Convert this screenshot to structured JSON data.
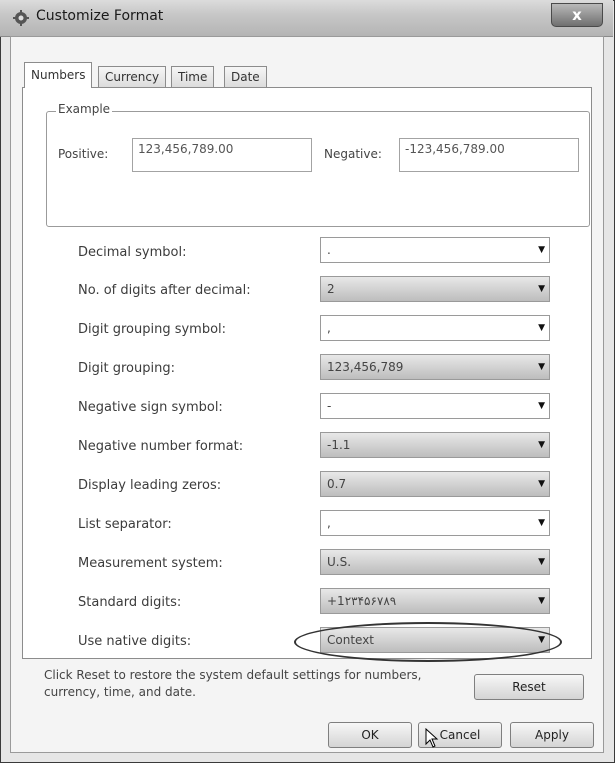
{
  "window": {
    "title": "Customize Format",
    "close_label": "x"
  },
  "tabs": [
    {
      "label": "Numbers",
      "active": true
    },
    {
      "label": "Currency",
      "active": false
    },
    {
      "label": "Time",
      "active": false
    },
    {
      "label": "Date",
      "active": false
    }
  ],
  "example": {
    "group_label": "Example",
    "positive_label": "Positive:",
    "positive_value": "123,456,789.00",
    "negative_label": "Negative:",
    "negative_value": "-123,456,789.00"
  },
  "settings": [
    {
      "label": "Decimal symbol:",
      "value": ".",
      "style": "white"
    },
    {
      "label": "No. of digits after decimal:",
      "value": "2",
      "style": "grey"
    },
    {
      "label": "Digit grouping symbol:",
      "value": ",",
      "style": "white"
    },
    {
      "label": "Digit grouping:",
      "value": "123,456,789",
      "style": "grey"
    },
    {
      "label": "Negative sign symbol:",
      "value": "-",
      "style": "white"
    },
    {
      "label": "Negative number format:",
      "value": "-1.1",
      "style": "grey"
    },
    {
      "label": "Display leading zeros:",
      "value": "0.7",
      "style": "grey"
    },
    {
      "label": "List separator:",
      "value": ",",
      "style": "white"
    },
    {
      "label": "Measurement system:",
      "value": "U.S.",
      "style": "grey"
    },
    {
      "label": "Standard digits:",
      "value": "+1۲۳۴۵۶۷۸۹",
      "style": "grey"
    },
    {
      "label": "Use native digits:",
      "value": "Context",
      "style": "grey"
    }
  ],
  "reset": {
    "text": "Click Reset to restore the system default settings for numbers, currency, time, and date.",
    "button_label": "Reset"
  },
  "footer": {
    "ok_label": "OK",
    "cancel_label": "Cancel",
    "apply_label": "Apply"
  }
}
